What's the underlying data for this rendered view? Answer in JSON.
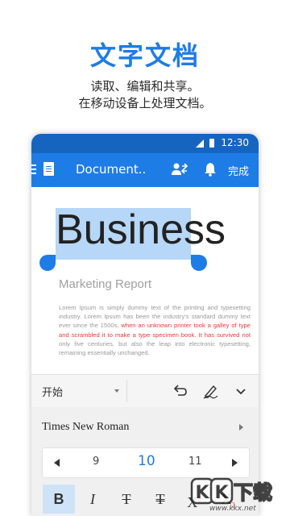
{
  "promo": {
    "title": "文字文档",
    "line1": "读取、编辑和共享。",
    "line2": "在移动设备上处理文档。"
  },
  "status_bar": {
    "time": "12:30"
  },
  "app_bar": {
    "doc_title": "Document..",
    "done_label": "完成"
  },
  "document": {
    "heading": "Business",
    "subtitle": "Marketing Report",
    "body_before": "Lorem Ipsum is simply dummy text of the printing and typesetting industry. Lorem Ipsum has been the industry's standard dummy text ever since the 1500s, ",
    "body_red": "when an unknown printer took a galley of type and scrambled it to make a type specimen book. It has survived not",
    "body_after": " only five centuries, but also the leap into electronic typesetting, remaining essentially unchanged."
  },
  "toolbar": {
    "style_label": "开始"
  },
  "format_panel": {
    "font_name": "Times New Roman",
    "sizes": [
      "9",
      "10",
      "11"
    ],
    "selected_size": "10",
    "buttons": {
      "bold": "B",
      "italic": "I",
      "strikethrough": "T",
      "double_strikethrough": "T",
      "superscript": "X",
      "subscript": "X"
    }
  },
  "watermark": {
    "logo_text": "KK下载",
    "url": "www.kkx.net"
  },
  "colors": {
    "accent": "#1e7ce6",
    "status_bar": "#1565c0",
    "red_text": "#e63a3a",
    "selection": "#b6d7f7"
  }
}
